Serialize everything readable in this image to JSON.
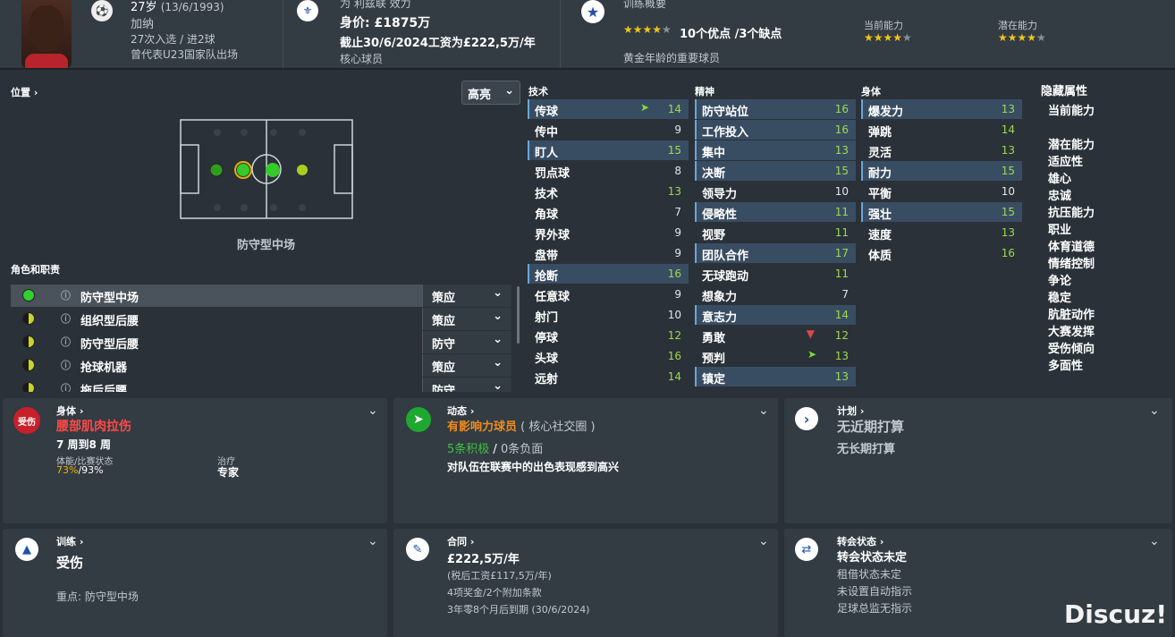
{
  "header": {
    "age": "27岁",
    "dob": "(13/6/1993)",
    "nation": "加纳",
    "caps": "27次入选 / 进2球",
    "youth": "曾代表U23国家队出场",
    "club_line": "为 利兹联 效力",
    "value": "身价: £1875万",
    "wage": "截止30/6/2024工资为£222,5万/年",
    "status": "核心球员",
    "scout_title": "训练概要",
    "scout_summary": "10个优点 /3个缺点",
    "scout_note": "黄金年龄的重要球员",
    "ca_label": "当前能力",
    "pa_label": "潜在能力"
  },
  "position": {
    "label": "位置",
    "role_name": "防守型中场",
    "roles_label": "角色和职责",
    "brightness": "高亮"
  },
  "roles": [
    {
      "name": "防守型中场",
      "duty": "策应",
      "color": "#2ed12e",
      "half": false
    },
    {
      "name": "组织型后腰",
      "duty": "策应",
      "color": "#c9d42a",
      "half": true
    },
    {
      "name": "防守型后腰",
      "duty": "防守",
      "color": "#c9d42a",
      "half": true
    },
    {
      "name": "抢球机器",
      "duty": "策应",
      "color": "#c9d42a",
      "half": true
    },
    {
      "name": "拖后后腰",
      "duty": "防守",
      "color": "#c9d42a",
      "half": true
    }
  ],
  "tech_head": "技术",
  "mental_head": "精神",
  "phys_head": "身体",
  "hidden_head": "隐藏属性",
  "technical": [
    {
      "n": "传球",
      "v": "14",
      "hl": true,
      "arrow": "up"
    },
    {
      "n": "传中",
      "v": "9"
    },
    {
      "n": "盯人",
      "v": "15",
      "hl": true
    },
    {
      "n": "罚点球",
      "v": "8"
    },
    {
      "n": "技术",
      "v": "13"
    },
    {
      "n": "角球",
      "v": "7"
    },
    {
      "n": "界外球",
      "v": "9"
    },
    {
      "n": "盘带",
      "v": "9"
    },
    {
      "n": "抢断",
      "v": "16",
      "hl": true
    },
    {
      "n": "任意球",
      "v": "9"
    },
    {
      "n": "射门",
      "v": "10"
    },
    {
      "n": "停球",
      "v": "12"
    },
    {
      "n": "头球",
      "v": "16"
    },
    {
      "n": "远射",
      "v": "14"
    }
  ],
  "mental": [
    {
      "n": "防守站位",
      "v": "16",
      "hl": true
    },
    {
      "n": "工作投入",
      "v": "16",
      "hl": true
    },
    {
      "n": "集中",
      "v": "13",
      "hl": true
    },
    {
      "n": "决断",
      "v": "15",
      "hl": true
    },
    {
      "n": "领导力",
      "v": "10"
    },
    {
      "n": "侵略性",
      "v": "11",
      "hl": true
    },
    {
      "n": "视野",
      "v": "11"
    },
    {
      "n": "团队合作",
      "v": "17",
      "hl": true
    },
    {
      "n": "无球跑动",
      "v": "11"
    },
    {
      "n": "想象力",
      "v": "7"
    },
    {
      "n": "意志力",
      "v": "14",
      "hl": true
    },
    {
      "n": "勇敢",
      "v": "12",
      "arrow": "down"
    },
    {
      "n": "预判",
      "v": "13",
      "arrow": "up"
    },
    {
      "n": "镇定",
      "v": "13",
      "hl": true
    }
  ],
  "physical": [
    {
      "n": "爆发力",
      "v": "13",
      "hl": true
    },
    {
      "n": "弹跳",
      "v": "14"
    },
    {
      "n": "灵活",
      "v": "13"
    },
    {
      "n": "耐力",
      "v": "15",
      "hl": true
    },
    {
      "n": "平衡",
      "v": "10"
    },
    {
      "n": "强壮",
      "v": "15",
      "hl": true
    },
    {
      "n": "速度",
      "v": "13"
    },
    {
      "n": "体质",
      "v": "16"
    }
  ],
  "hidden": [
    "当前能力",
    "潜在能力",
    "适应性",
    "雄心",
    "忠诚",
    "抗压能力",
    "职业",
    "体育道德",
    "情绪控制",
    "争论",
    "稳定",
    "肮脏动作",
    "大赛发挥",
    "受伤倾向",
    "多面性"
  ],
  "panels": {
    "body": {
      "title": "身体",
      "badge": "受伤",
      "injury": "腰部肌肉拉伤",
      "duration": "7 周到8 周",
      "cond_label": "体能/比赛状态",
      "cond_a": "73%",
      "cond_b": "/93%",
      "treat_label": "治疗",
      "treat_val": "专家"
    },
    "dynamics": {
      "title": "动态",
      "role": "有影响力球员",
      "group": "( 核心社交圈 )",
      "pos": "5条积极",
      "sep": " / ",
      "neg": "0条负面",
      "note": "对队伍在联赛中的出色表现感到高兴"
    },
    "plans": {
      "title": "计划",
      "l1": "无近期打算",
      "l2": "无长期打算"
    },
    "training": {
      "title": "训练",
      "status": "受伤",
      "focus": "重点: 防守型中场"
    },
    "contract": {
      "title": "合同",
      "wage": "£222,5万/年",
      "after_tax": "(税后工资£117,5万/年)",
      "bonus": "4项奖金/2个附加条款",
      "expiry": "3年零8个月后到期 (30/6/2024)"
    },
    "transfer": {
      "title": "转会状态",
      "status": "转会状态未定",
      "l1": "租借状态未定",
      "l2": "未设置自动指示",
      "l3": "足球总监无指示"
    }
  },
  "watermark": "Discuz!"
}
